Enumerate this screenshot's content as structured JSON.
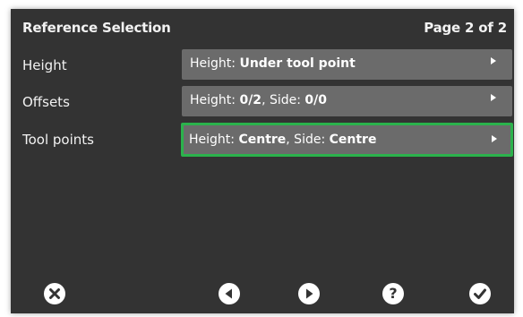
{
  "header": {
    "title": "Reference Selection",
    "page_indicator": "Page 2 of 2"
  },
  "rows": [
    {
      "label": "Height",
      "value_parts": [
        {
          "text": "Height: ",
          "bold": false
        },
        {
          "text": "Under tool point",
          "bold": true
        }
      ],
      "selected": false
    },
    {
      "label": "Offsets",
      "value_parts": [
        {
          "text": "Height: ",
          "bold": false
        },
        {
          "text": "0/2",
          "bold": true
        },
        {
          "text": ", Side: ",
          "bold": false
        },
        {
          "text": "0/0",
          "bold": true
        }
      ],
      "selected": false
    },
    {
      "label": "Tool points",
      "value_parts": [
        {
          "text": "Height: ",
          "bold": false
        },
        {
          "text": "Centre",
          "bold": true
        },
        {
          "text": ", Side: ",
          "bold": false
        },
        {
          "text": "Centre",
          "bold": true
        }
      ],
      "selected": true
    }
  ],
  "footer": {
    "buttons": [
      "close-icon",
      "back-icon",
      "forward-icon",
      "help-icon",
      "confirm-icon"
    ],
    "help_glyph": "?"
  },
  "colors": {
    "background": "#333333",
    "button": "#6b6b6b",
    "selected_border": "#2bb24c",
    "text": "#f2f2f2"
  }
}
